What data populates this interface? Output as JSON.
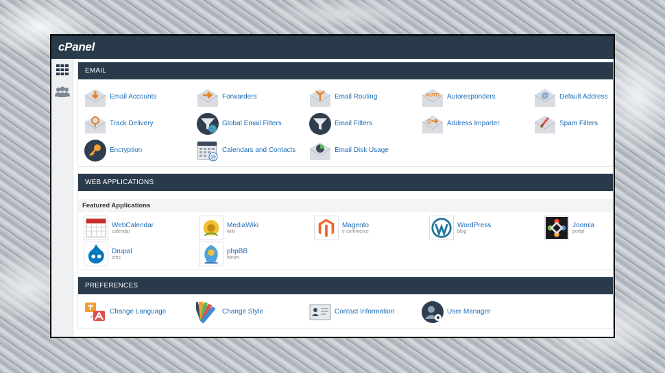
{
  "brand": {
    "logo": "cPanel"
  },
  "email": {
    "title": "EMAIL",
    "items": [
      {
        "label": "Email Accounts",
        "icon": "email-accounts-icon"
      },
      {
        "label": "Forwarders",
        "icon": "forwarders-icon"
      },
      {
        "label": "Email Routing",
        "icon": "email-routing-icon"
      },
      {
        "label": "Autoresponders",
        "icon": "autoresponders-icon"
      },
      {
        "label": "Default Address",
        "icon": "default-address-icon"
      },
      {
        "label": "Track Delivery",
        "icon": "track-delivery-icon"
      },
      {
        "label": "Global Email Filters",
        "icon": "global-email-filters-icon"
      },
      {
        "label": "Email Filters",
        "icon": "email-filters-icon"
      },
      {
        "label": "Address Importer",
        "icon": "address-importer-icon"
      },
      {
        "label": "Spam Filters",
        "icon": "spam-filters-icon"
      },
      {
        "label": "Encryption",
        "icon": "encryption-icon"
      },
      {
        "label": "Calendars and Contacts",
        "icon": "calendars-contacts-icon"
      },
      {
        "label": "Email Disk Usage",
        "icon": "email-disk-usage-icon"
      }
    ],
    "auto_badge": "AUTO",
    "at_sign": "@"
  },
  "webapps": {
    "title": "WEB APPLICATIONS",
    "featured_title": "Featured Applications",
    "apps": [
      {
        "name": "WebCalendar",
        "sub": "calendar"
      },
      {
        "name": "MediaWiki",
        "sub": "wiki"
      },
      {
        "name": "Magento",
        "sub": "e-commerce"
      },
      {
        "name": "WordPress",
        "sub": "blog"
      },
      {
        "name": "Joomla",
        "sub": "portal"
      },
      {
        "name": "Drupal",
        "sub": "cms"
      },
      {
        "name": "phpBB",
        "sub": "forum"
      }
    ]
  },
  "preferences": {
    "title": "PREFERENCES",
    "items": [
      {
        "label": "Change Language",
        "icon": "change-language-icon"
      },
      {
        "label": "Change Style",
        "icon": "change-style-icon"
      },
      {
        "label": "Contact Information",
        "icon": "contact-information-icon"
      },
      {
        "label": "User Manager",
        "icon": "user-manager-icon"
      }
    ]
  },
  "colors": {
    "header": "#293a4a",
    "link": "#1f6db5",
    "accent": "#e8822a"
  }
}
